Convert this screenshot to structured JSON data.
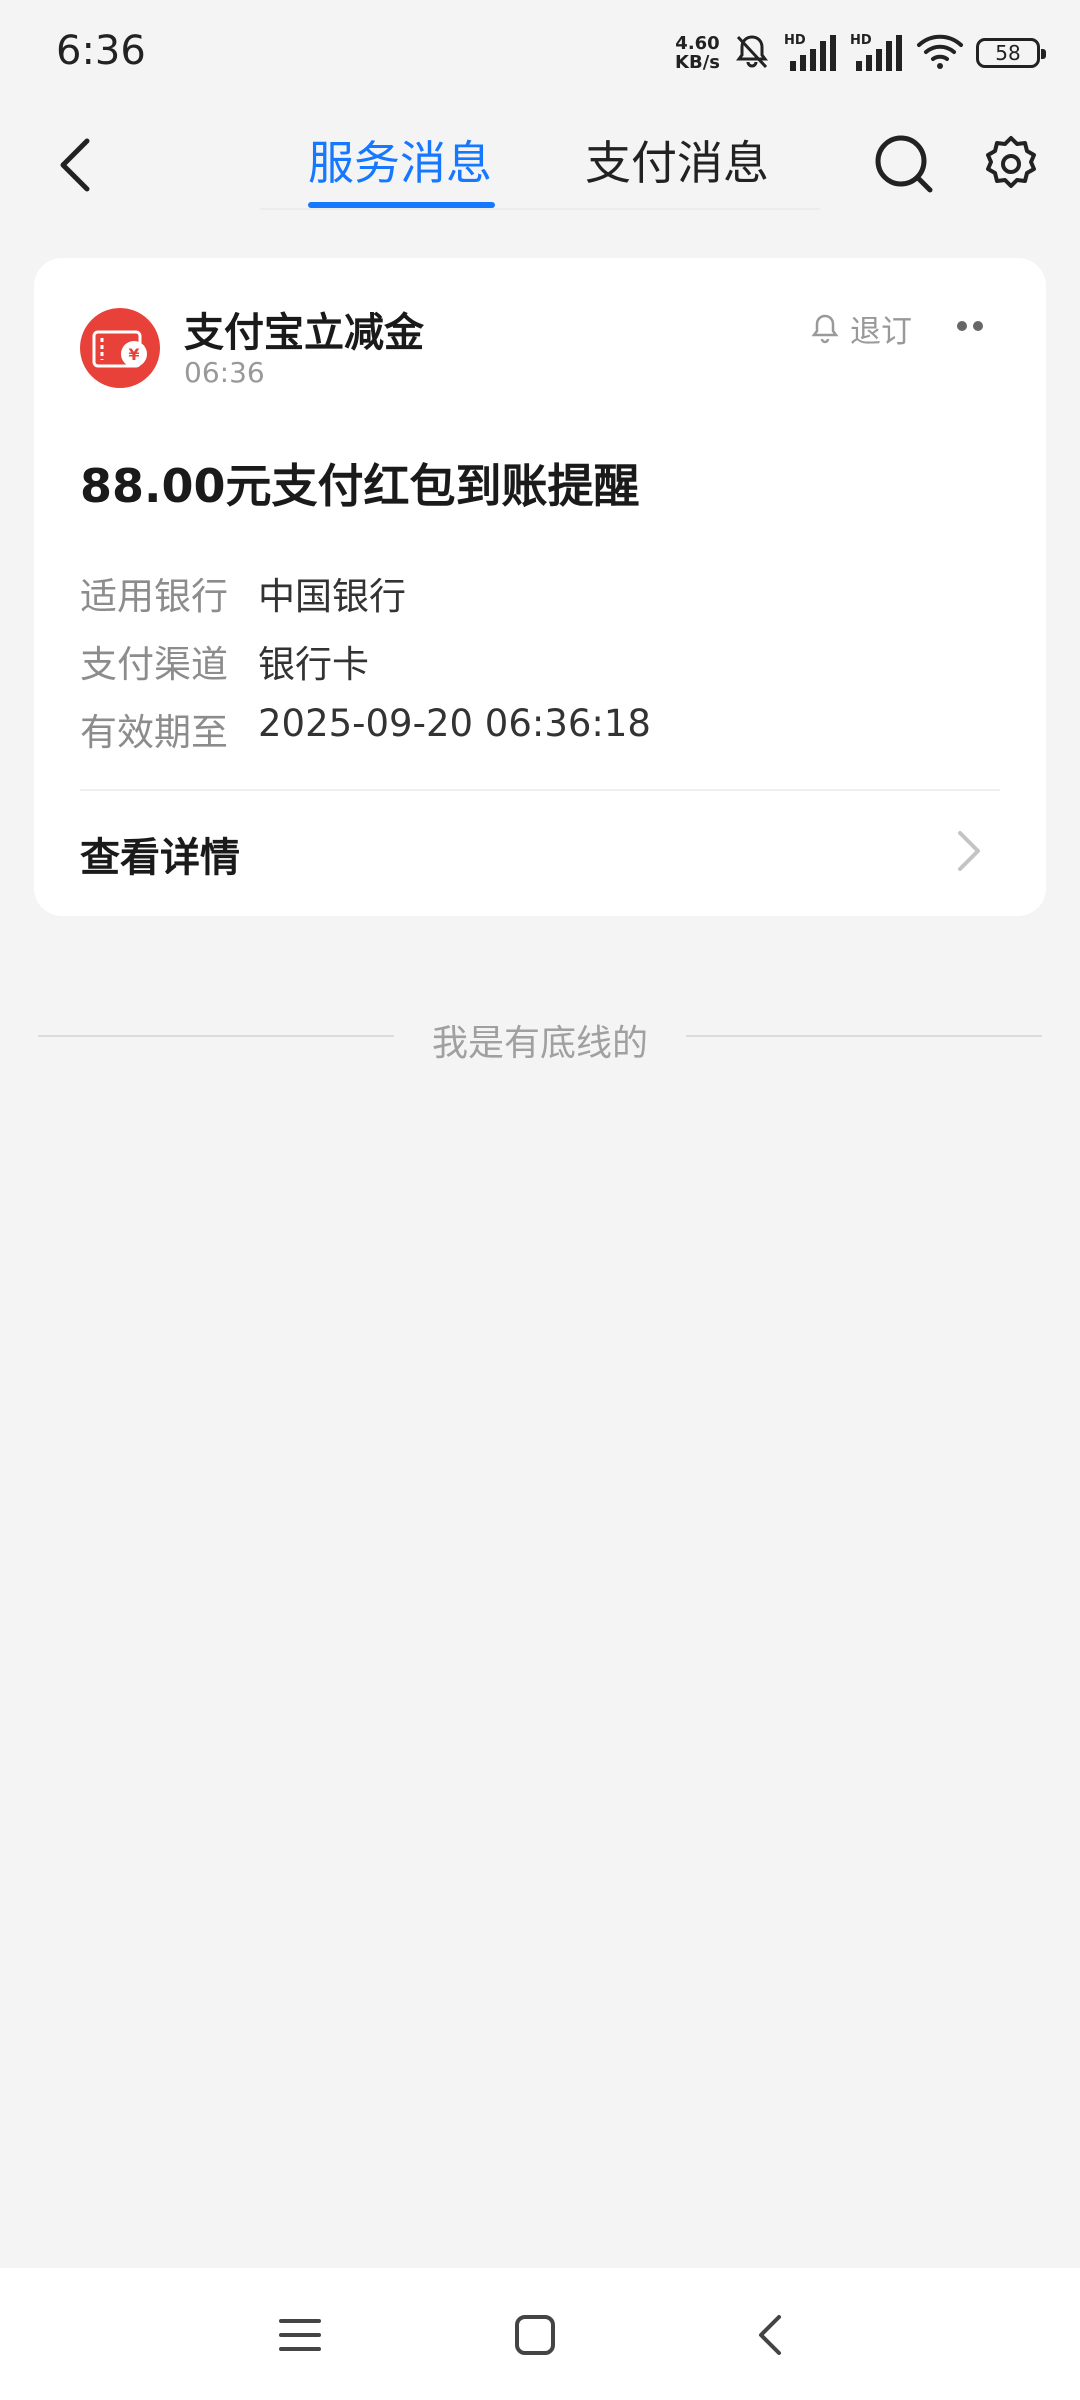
{
  "status_bar": {
    "time": "6:36",
    "net_speed_value": "4.60",
    "net_speed_unit": "KB/s",
    "sim1_label": "HD",
    "sim2_label": "HD",
    "battery": "58",
    "icons": [
      "mute-bell-icon",
      "signal-icon",
      "signal-icon",
      "wifi-icon",
      "battery-icon"
    ]
  },
  "header": {
    "tabs": [
      {
        "label": "服务消息",
        "active": true
      },
      {
        "label": "支付消息",
        "active": false
      }
    ],
    "accent_color": "#1677ff",
    "icons": [
      "back-arrow-icon",
      "search-icon",
      "gear-icon"
    ]
  },
  "message_card": {
    "sender": "支付宝立减金",
    "time": "06:36",
    "unsubscribe_label": "退订",
    "title": "88.00元支付红包到账提醒",
    "fields": [
      {
        "key": "适用银行",
        "value": "中国银行"
      },
      {
        "key": "支付渠道",
        "value": "银行卡"
      },
      {
        "key": "有效期至",
        "value": "2025-09-20 06:36:18"
      }
    ],
    "detail_label": "查看详情",
    "avatar_color": "#e8413a"
  },
  "footer": {
    "end_text": "我是有底线的"
  },
  "nav_bar": {
    "icons": [
      "menu-icon",
      "home-square-icon",
      "back-chevron-icon"
    ]
  }
}
